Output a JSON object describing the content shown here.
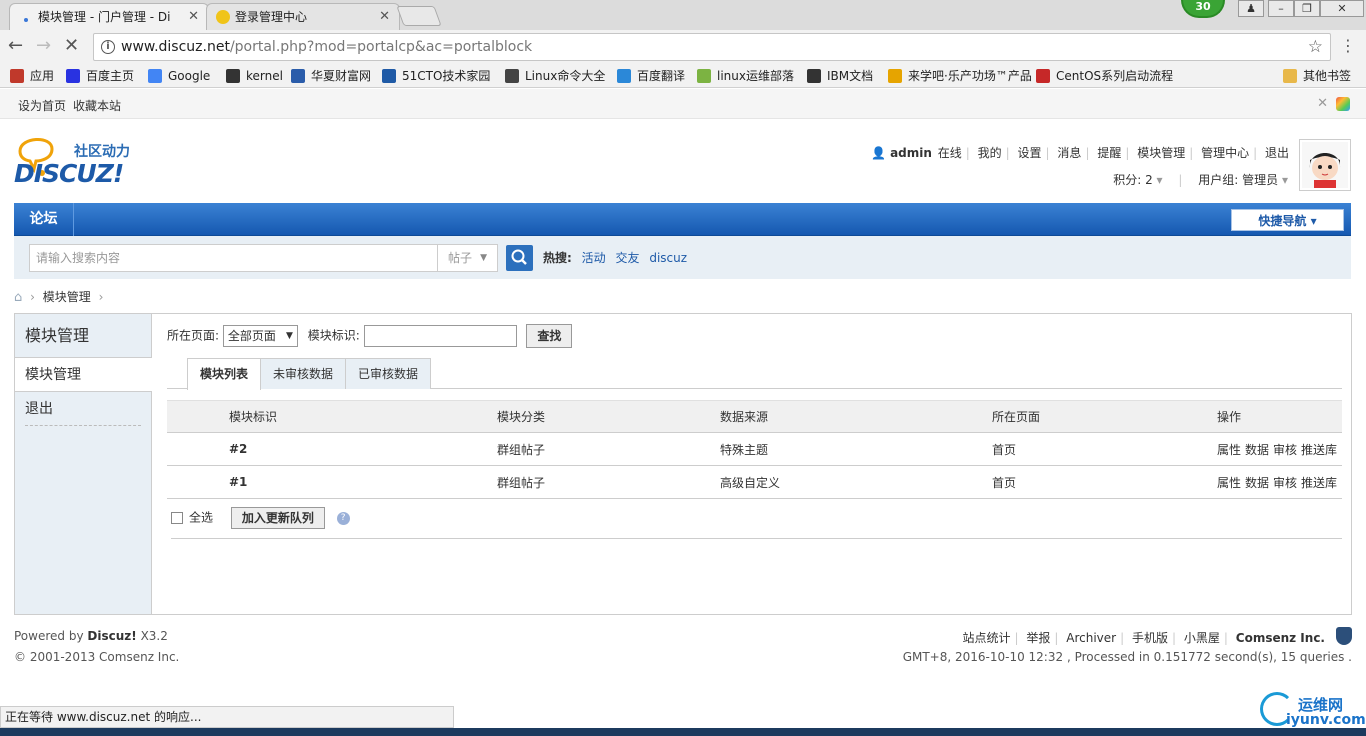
{
  "browser": {
    "tabs": [
      {
        "title": "模块管理 - 门户管理 - Di",
        "active": true
      },
      {
        "title": "登录管理中心",
        "active": false
      }
    ],
    "badge_count": "30",
    "url": {
      "host": "www.discuz.net",
      "path": "/portal.php?mod=portalcp&ac=portalblock"
    },
    "bookmarks": [
      {
        "label": "应用",
        "icon": "apps-grid-icon",
        "color": "#c0392b"
      },
      {
        "label": "百度主页",
        "icon": "baidu-paw-icon",
        "color": "#2932e1"
      },
      {
        "label": "Google",
        "icon": "google-icon",
        "color": "#4285f4"
      },
      {
        "label": "kernel",
        "icon": "linux-tux-icon",
        "color": "#333333"
      },
      {
        "label": "华夏财富网",
        "icon": "globe-icon",
        "color": "#2a5caa"
      },
      {
        "label": "51CTO技术家园",
        "icon": "51cto-icon",
        "color": "#1f5aa6"
      },
      {
        "label": "Linux命令大全",
        "icon": "diamond-icon",
        "color": "#444444"
      },
      {
        "label": "百度翻译",
        "icon": "translate-icon",
        "color": "#2b88d8"
      },
      {
        "label": "linux运维部落",
        "icon": "leaf-icon",
        "color": "#7cb342"
      },
      {
        "label": "IBM文档",
        "icon": "ibm-icon",
        "color": "#333333"
      },
      {
        "label": "来学吧·乐产功场™产品",
        "icon": "bulb-icon",
        "color": "#e6a400"
      },
      {
        "label": "CentOS系列启动流程",
        "icon": "centos-icon",
        "color": "#c62828"
      }
    ],
    "other_bookmarks": "其他书签",
    "status": "正在等待 www.discuz.net 的响应..."
  },
  "topbar": {
    "set_home": "设为首页",
    "bookmark": "收藏本站"
  },
  "logo": {
    "slogan": "社区动力",
    "brand": "DISCUZ!"
  },
  "user": {
    "name": "admin",
    "online": "在线",
    "menu": [
      "我的",
      "设置",
      "消息",
      "提醒",
      "模块管理",
      "管理中心",
      "退出"
    ],
    "points": "积分: 2",
    "group": "用户组: 管理员"
  },
  "nav": {
    "forum": "论坛",
    "quick_nav": "快捷导航"
  },
  "search": {
    "placeholder": "请输入搜索内容",
    "type": "帖子",
    "hot_label": "热搜:",
    "hot": [
      "活动",
      "交友",
      "discuz"
    ]
  },
  "breadcrumb": {
    "current": "模块管理"
  },
  "sidebar": {
    "title": "模块管理",
    "items": [
      "模块管理",
      "退出"
    ]
  },
  "filter": {
    "page_label": "所在页面:",
    "page_value": "全部页面",
    "id_label": "模块标识:",
    "search_btn": "查找"
  },
  "tabs": [
    "模块列表",
    "未审核数据",
    "已审核数据"
  ],
  "table": {
    "headers": [
      "模块标识",
      "模块分类",
      "数据来源",
      "所在页面",
      "操作"
    ],
    "rows": [
      {
        "id": "#2",
        "category": "群组帖子",
        "source": "特殊主题",
        "page": "首页",
        "ops": [
          "属性",
          "数据",
          "审核",
          "推送库"
        ]
      },
      {
        "id": "#1",
        "category": "群组帖子",
        "source": "高级自定义",
        "page": "首页",
        "ops": [
          "属性",
          "数据",
          "审核",
          "推送库"
        ]
      }
    ]
  },
  "bulk": {
    "select_all": "全选",
    "queue_btn": "加入更新队列"
  },
  "footer": {
    "powered_by": "Powered by",
    "product": "Discuz!",
    "version": "X3.2",
    "copyright": "© 2001-2013 Comsenz Inc.",
    "links": [
      "站点统计",
      "举报",
      "Archiver",
      "手机版",
      "小黑屋"
    ],
    "company": "Comsenz Inc.",
    "stats": "GMT+8, 2016-10-10 12:32 , Processed in 0.151772 second(s), 15 queries ."
  },
  "watermark": {
    "line1": "运维网",
    "line2": "iyunv.com"
  }
}
